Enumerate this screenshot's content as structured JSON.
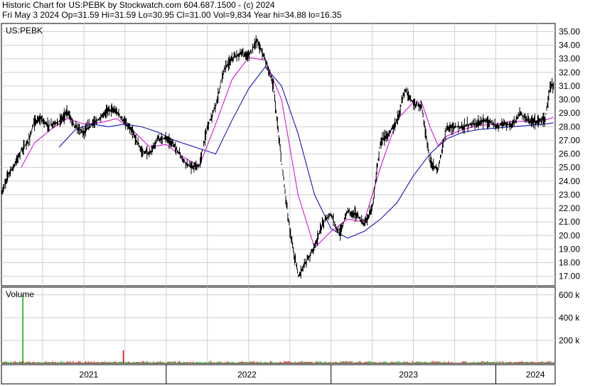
{
  "header": {
    "line1": "Historic Chart for US:PEBK by Stockwatch.com 604.687.1500 - (c) 2024",
    "line2": "Fri May  3 2024   Op=31.59   Hi=31.59   Lo=30.95   Cl=31.00   Vol=9,834   Year hi=34.88   lo=16.35"
  },
  "chart_data": {
    "type": "line",
    "symbol_label": "US:PEBK",
    "price_axis": {
      "ticks": [
        "35.00",
        "34.00",
        "33.00",
        "32.00",
        "31.00",
        "30.00",
        "29.00",
        "28.00",
        "27.00",
        "26.00",
        "25.00",
        "24.00",
        "23.00",
        "22.00",
        "21.00",
        "20.00",
        "19.00",
        "18.00",
        "17.00"
      ],
      "ylim": [
        16.3,
        35.6
      ]
    },
    "volume_panel": {
      "title": "Volume",
      "ticks": [
        "600 k",
        "400 k",
        "200 k"
      ],
      "ylim": [
        0,
        630000
      ],
      "spikes": [
        {
          "x": 0.13,
          "value": 600000,
          "color": "#00aa00"
        },
        {
          "x": 0.74,
          "value": 115000,
          "color": "#dd0000"
        }
      ]
    },
    "x_labels": [
      {
        "label": "2021",
        "x": 0.53
      },
      {
        "label": "2022",
        "x": 1.49
      },
      {
        "label": "2023",
        "x": 2.47
      },
      {
        "label": "2024",
        "x": 3.24
      }
    ],
    "year_boundaries": [
      1.0,
      2.0,
      3.0
    ],
    "price_series": {
      "name": "price",
      "color": "#000000",
      "x": [
        0.0,
        0.04,
        0.08,
        0.12,
        0.16,
        0.2,
        0.24,
        0.28,
        0.32,
        0.36,
        0.4,
        0.45,
        0.5,
        0.55,
        0.6,
        0.65,
        0.7,
        0.75,
        0.8,
        0.85,
        0.9,
        0.95,
        1.0,
        1.05,
        1.1,
        1.15,
        1.2,
        1.25,
        1.3,
        1.35,
        1.4,
        1.45,
        1.5,
        1.55,
        1.6,
        1.65,
        1.7,
        1.75,
        1.8,
        1.85,
        1.9,
        1.95,
        2.0,
        2.05,
        2.1,
        2.15,
        2.2,
        2.25,
        2.3,
        2.35,
        2.4,
        2.45,
        2.5,
        2.55,
        2.6,
        2.65,
        2.7,
        2.75,
        2.8,
        2.85,
        2.9,
        2.95,
        3.0,
        3.05,
        3.1,
        3.15,
        3.2,
        3.25,
        3.3,
        3.33,
        3.35
      ],
      "values": [
        23.0,
        24.5,
        25.2,
        26.3,
        26.8,
        28.3,
        28.6,
        28.1,
        28.2,
        28.5,
        29.1,
        28.0,
        27.6,
        28.2,
        28.6,
        29.3,
        29.1,
        28.3,
        27.5,
        26.2,
        26.0,
        27.1,
        27.2,
        26.6,
        25.6,
        25.0,
        25.1,
        28.0,
        29.5,
        32.2,
        33.0,
        33.4,
        33.2,
        34.4,
        33.0,
        31.0,
        25.3,
        20.4,
        17.0,
        18.1,
        19.2,
        20.9,
        21.6,
        20.0,
        21.8,
        21.6,
        20.8,
        22.0,
        26.9,
        27.5,
        28.5,
        30.7,
        29.7,
        29.5,
        25.4,
        24.8,
        27.9,
        28.0,
        28.0,
        28.2,
        28.3,
        28.5,
        28.0,
        28.3,
        28.1,
        29.0,
        28.4,
        28.4,
        28.6,
        31.0,
        31.0
      ]
    },
    "ma_fast": {
      "name": "moving average (fast)",
      "color": "#d000d0",
      "x": [
        0.12,
        0.2,
        0.3,
        0.4,
        0.5,
        0.6,
        0.7,
        0.8,
        0.9,
        1.0,
        1.1,
        1.2,
        1.3,
        1.4,
        1.5,
        1.6,
        1.7,
        1.8,
        1.9,
        2.0,
        2.1,
        2.2,
        2.3,
        2.4,
        2.5,
        2.55,
        2.6,
        2.65,
        2.7,
        2.8,
        2.9,
        3.0,
        3.1,
        3.2,
        3.3,
        3.35
      ],
      "values": [
        25.0,
        26.8,
        27.8,
        28.6,
        28.2,
        28.3,
        28.6,
        27.7,
        26.5,
        26.7,
        25.8,
        25.1,
        28.2,
        31.5,
        33.1,
        32.9,
        30.0,
        23.0,
        19.1,
        20.3,
        21.2,
        21.0,
        25.0,
        28.5,
        29.8,
        29.8,
        28.0,
        26.6,
        27.3,
        27.8,
        28.1,
        28.2,
        28.4,
        28.4,
        28.5,
        28.7
      ]
    },
    "ma_slow": {
      "name": "moving average (slow)",
      "color": "#0000bb",
      "x": [
        0.35,
        0.45,
        0.55,
        0.65,
        0.75,
        0.85,
        0.95,
        1.05,
        1.15,
        1.25,
        1.3,
        1.4,
        1.5,
        1.6,
        1.7,
        1.8,
        1.9,
        2.0,
        2.1,
        2.2,
        2.3,
        2.4,
        2.5,
        2.6,
        2.7,
        2.8,
        2.9,
        3.0,
        3.1,
        3.2,
        3.3,
        3.35
      ],
      "values": [
        26.5,
        27.8,
        28.2,
        28.0,
        28.2,
        28.0,
        27.6,
        27.0,
        26.6,
        26.2,
        26.0,
        28.5,
        30.8,
        32.4,
        31.0,
        27.5,
        23.0,
        20.5,
        19.8,
        20.3,
        21.2,
        22.4,
        24.4,
        26.0,
        27.1,
        27.6,
        27.8,
        27.9,
        28.0,
        28.1,
        28.2,
        28.3
      ]
    }
  }
}
